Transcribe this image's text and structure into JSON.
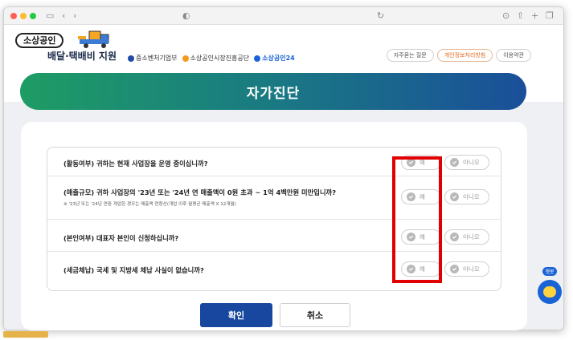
{
  "browser": {
    "icons": [
      "sidebar-icon",
      "back-icon",
      "forward-icon",
      "privacy-shield-icon",
      "reload-icon",
      "downloads-icon",
      "share-icon",
      "new-tab-icon",
      "tabs-overview-icon"
    ]
  },
  "header": {
    "logo_badge": "소상공인",
    "logo_title": "배달·택배비 지원",
    "partners": [
      "중소벤처기업부",
      "소상공인시장진흥공단",
      "소상공인24"
    ],
    "links": [
      "자주묻는 질문",
      "개인정보처리방침",
      "이용약관"
    ]
  },
  "banner": {
    "title": "자가진단"
  },
  "questions": [
    {
      "text": "(활동여부) 귀하는 현재 사업장을 운영 중이십니까?",
      "note": "",
      "yes": "예",
      "no": "아니오"
    },
    {
      "text": "(매출규모) 귀하 사업장의 '23년 또는 '24년 연 매출액이 0원 초과 ~ 1억 4백만원 미만입니까?",
      "note": "※ '23년 또는 '24년 연중 개업한 경우는 매출액 연환산(개업 이후 월평균 매출액 X 12개월)",
      "yes": "예",
      "no": "아니오"
    },
    {
      "text": "(본인여부) 대표자 본인이 신청하십니까?",
      "note": "",
      "yes": "예",
      "no": "아니오"
    },
    {
      "text": "(세금체납) 국세 및 지방세 체납 사실이 없습니까?",
      "note": "",
      "yes": "예",
      "no": "아니오"
    }
  ],
  "actions": {
    "confirm": "확인",
    "cancel": "취소"
  },
  "chatbot": {
    "label": "챗봇"
  },
  "colors": {
    "banner_start": "#1e9c64",
    "banner_end": "#1a4f9a",
    "confirm": "#17479e",
    "highlight": "#e00000"
  }
}
